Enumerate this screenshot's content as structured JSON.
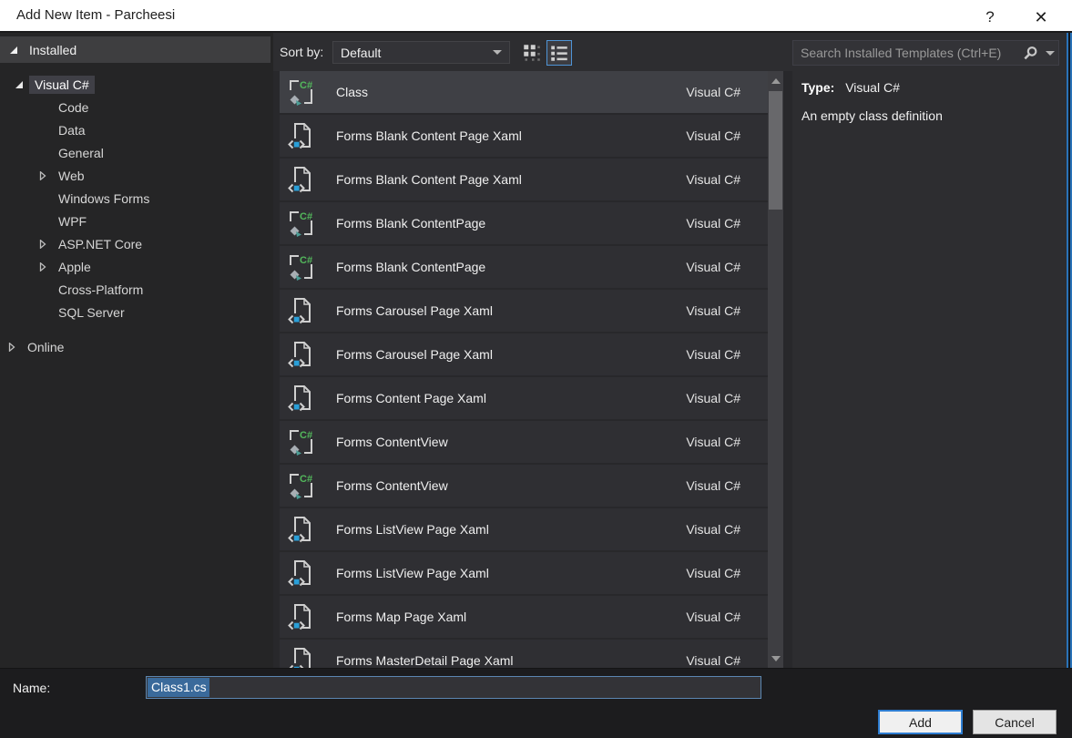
{
  "window": {
    "title": "Add New Item - Parcheesi",
    "help_glyph": "?",
    "close_glyph": "✕"
  },
  "left_panel": {
    "installed": {
      "label": "Installed"
    },
    "online": {
      "label": "Online"
    },
    "tree_items": [
      {
        "label": "Visual C#",
        "arrow": "expanded",
        "indent": 1,
        "selected": true
      },
      {
        "label": "Code",
        "arrow": "none",
        "indent": 2,
        "selected": false
      },
      {
        "label": "Data",
        "arrow": "none",
        "indent": 2,
        "selected": false
      },
      {
        "label": "General",
        "arrow": "none",
        "indent": 2,
        "selected": false
      },
      {
        "label": "Web",
        "arrow": "collapsed",
        "indent": 2,
        "selected": false
      },
      {
        "label": "Windows Forms",
        "arrow": "none",
        "indent": 2,
        "selected": false
      },
      {
        "label": "WPF",
        "arrow": "none",
        "indent": 2,
        "selected": false
      },
      {
        "label": "ASP.NET Core",
        "arrow": "collapsed",
        "indent": 2,
        "selected": false
      },
      {
        "label": "Apple",
        "arrow": "collapsed",
        "indent": 2,
        "selected": false
      },
      {
        "label": "Cross-Platform",
        "arrow": "none",
        "indent": 2,
        "selected": false
      },
      {
        "label": "SQL Server",
        "arrow": "none",
        "indent": 2,
        "selected": false
      }
    ]
  },
  "toolbar": {
    "sort_by_label": "Sort by:",
    "sort_value": "Default"
  },
  "template_list": {
    "items": [
      {
        "name": "Class",
        "language": "Visual C#",
        "icon": "csharp-class",
        "selected": true
      },
      {
        "name": "Forms Blank Content Page Xaml",
        "language": "Visual C#",
        "icon": "xaml-page",
        "selected": false
      },
      {
        "name": "Forms Blank Content Page Xaml",
        "language": "Visual C#",
        "icon": "xaml-page",
        "selected": false
      },
      {
        "name": "Forms Blank ContentPage",
        "language": "Visual C#",
        "icon": "csharp-class",
        "selected": false
      },
      {
        "name": "Forms Blank ContentPage",
        "language": "Visual C#",
        "icon": "csharp-class",
        "selected": false
      },
      {
        "name": "Forms Carousel Page Xaml",
        "language": "Visual C#",
        "icon": "xaml-page",
        "selected": false
      },
      {
        "name": "Forms Carousel Page Xaml",
        "language": "Visual C#",
        "icon": "xaml-page",
        "selected": false
      },
      {
        "name": "Forms Content Page Xaml",
        "language": "Visual C#",
        "icon": "xaml-page",
        "selected": false
      },
      {
        "name": "Forms ContentView",
        "language": "Visual C#",
        "icon": "csharp-class",
        "selected": false
      },
      {
        "name": "Forms ContentView",
        "language": "Visual C#",
        "icon": "csharp-class",
        "selected": false
      },
      {
        "name": "Forms ListView Page Xaml",
        "language": "Visual C#",
        "icon": "xaml-page",
        "selected": false
      },
      {
        "name": "Forms ListView Page Xaml",
        "language": "Visual C#",
        "icon": "xaml-page",
        "selected": false
      },
      {
        "name": "Forms Map Page Xaml",
        "language": "Visual C#",
        "icon": "xaml-page",
        "selected": false
      },
      {
        "name": "Forms MasterDetail Page Xaml",
        "language": "Visual C#",
        "icon": "xaml-page",
        "selected": false
      }
    ]
  },
  "search": {
    "placeholder": "Search Installed Templates (Ctrl+E)"
  },
  "details_panel": {
    "type_label": "Type:",
    "type_value": "Visual C#",
    "description": "An empty class definition"
  },
  "footer": {
    "name_label": "Name:",
    "name_value": "Class1.cs",
    "add_button": "Add",
    "cancel_button": "Cancel"
  },
  "colors": {
    "accent_blue": "#4f94d6",
    "selection_blue": "#3a6a9b",
    "edge_blue": "#2a72b8",
    "titlebar_bg": "#ffffff",
    "main_bg": "#2d2d30",
    "panel_bg": "#252526",
    "row_bg": "#2f2f33",
    "row_selected_bg": "#3f4045",
    "csharp_green": "#53b85c",
    "xaml_blue": "#2a9fd8"
  }
}
